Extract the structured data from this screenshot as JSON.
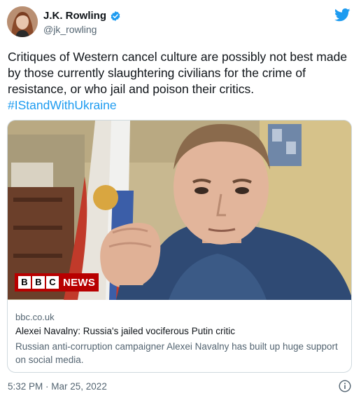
{
  "author": {
    "name": "J.K. Rowling",
    "handle": "@jk_rowling",
    "verified_icon": "verified-badge-icon",
    "avatar_icon": "avatar"
  },
  "brand_icon": "twitter-bird-icon",
  "tweet": {
    "text": "Critiques of Western cancel culture are possibly not best made by those currently slaughtering civilians for the crime of resistance, or who jail and poison their critics.",
    "hashtag": "#IStandWithUkraine"
  },
  "card": {
    "badge": {
      "letters": [
        "B",
        "B",
        "C"
      ],
      "label": "NEWS"
    },
    "domain": "bbc.co.uk",
    "title": "Alexei Navalny: Russia's jailed vociferous Putin critic",
    "description": "Russian anti-corruption campaigner Alexei Navalny has built up huge support on social media."
  },
  "timestamp": "5:32 PM · Mar 25, 2022",
  "info_icon": "info-icon",
  "colors": {
    "accent": "#1d9bf0",
    "text_primary": "#0f1419",
    "text_secondary": "#536471",
    "border": "#cfd9de",
    "bbc_red": "#b80000"
  }
}
